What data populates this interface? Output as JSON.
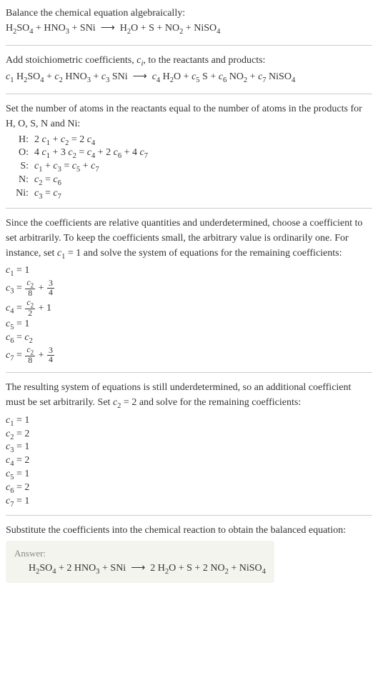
{
  "prompt": {
    "line1": "Balance the chemical equation algebraically:",
    "equation": "H₂SO₄ + HNO₃ + SNi ⟶ H₂O + S + NO₂ + NiSO₄"
  },
  "stoich": {
    "line1": "Add stoichiometric coefficients, cᵢ, to the reactants and products:",
    "equation": "c₁ H₂SO₄ + c₂ HNO₃ + c₃ SNi ⟶ c₄ H₂O + c₅ S + c₆ NO₂ + c₇ NiSO₄"
  },
  "atoms": {
    "intro": "Set the number of atoms in the reactants equal to the number of atoms in the products for H, O, S, N and Ni:",
    "rows": [
      {
        "el": "H:",
        "eq": "2 c₁ + c₂ = 2 c₄"
      },
      {
        "el": "O:",
        "eq": "4 c₁ + 3 c₂ = c₄ + 2 c₆ + 4 c₇"
      },
      {
        "el": "S:",
        "eq": "c₁ + c₃ = c₅ + c₇"
      },
      {
        "el": "N:",
        "eq": "c₂ = c₆"
      },
      {
        "el": "Ni:",
        "eq": "c₃ = c₇"
      }
    ]
  },
  "under1": {
    "intro": "Since the coefficients are relative quantities and underdetermined, choose a coefficient to set arbitrarily. To keep the coefficients small, the arbitrary value is ordinarily one. For instance, set c₁ = 1 and solve the system of equations for the remaining coefficients:"
  },
  "c1_eqs": {
    "c1": "c₁ = 1",
    "c3_pre": "c₃ = ",
    "c3_num": "c₂",
    "c3_den": "8",
    "c3_plus_num": "3",
    "c3_plus_den": "4",
    "c4_pre": "c₄ = ",
    "c4_num": "c₂",
    "c4_den": "2",
    "c4_tail": " + 1",
    "c5": "c₅ = 1",
    "c6": "c₆ = c₂",
    "c7_pre": "c₇ = ",
    "c7_num": "c₂",
    "c7_den": "8",
    "c7_plus_num": "3",
    "c7_plus_den": "4"
  },
  "under2": {
    "intro": "The resulting system of equations is still underdetermined, so an additional coefficient must be set arbitrarily. Set c₂ = 2 and solve for the remaining coefficients:",
    "vals": [
      "c₁ = 1",
      "c₂ = 2",
      "c₃ = 1",
      "c₄ = 2",
      "c₅ = 1",
      "c₆ = 2",
      "c₇ = 1"
    ]
  },
  "final": {
    "intro": "Substitute the coefficients into the chemical reaction to obtain the balanced equation:",
    "answer_label": "Answer:",
    "answer_eq": "H₂SO₄ + 2 HNO₃ + SNi ⟶ 2 H₂O + S + 2 NO₂ + NiSO₄"
  }
}
